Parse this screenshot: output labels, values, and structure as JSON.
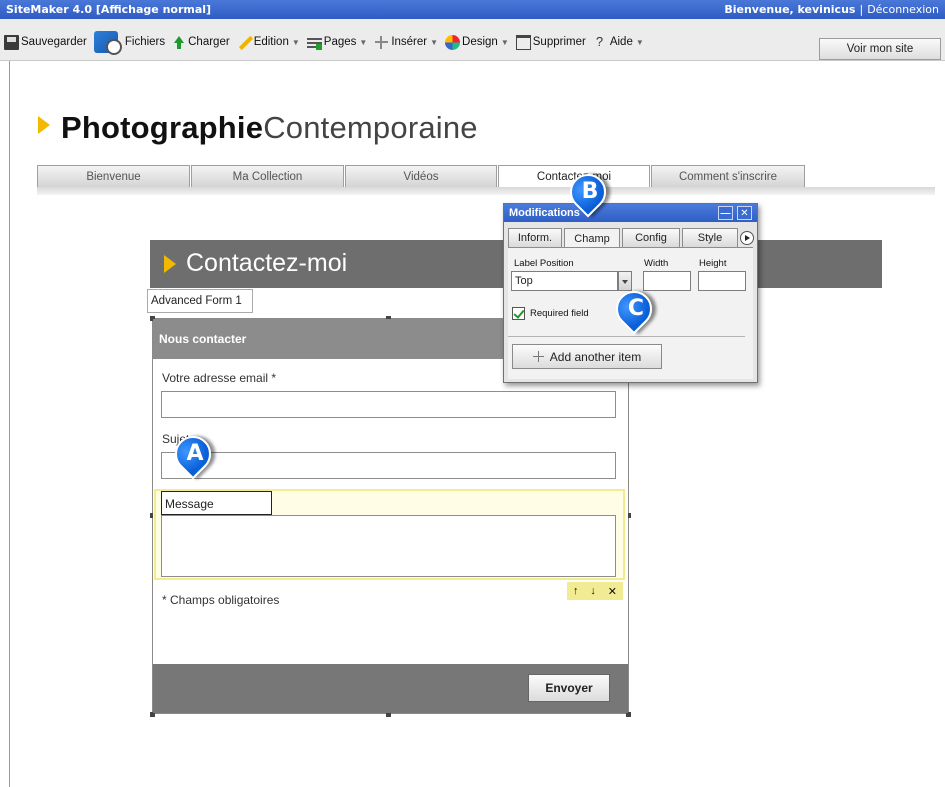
{
  "titlebar": {
    "app": "SiteMaker 4.0  [Affichage normal]",
    "welcome": "Bienvenue, kevinicus",
    "logout": "Déconnexion"
  },
  "toolbar": {
    "items": [
      {
        "label": "Sauvegarder",
        "icon": "save-icon"
      },
      {
        "label": "Fichiers",
        "icon": "files-icon"
      },
      {
        "label": "Charger",
        "icon": "upload-arrow-icon"
      },
      {
        "label": "Edition",
        "icon": "pencil-icon",
        "dropdown": true
      },
      {
        "label": "Pages",
        "icon": "pages-icon",
        "dropdown": true
      },
      {
        "label": "Insérer",
        "icon": "insert-icon",
        "dropdown": true
      },
      {
        "label": "Design",
        "icon": "design-icon",
        "dropdown": true
      },
      {
        "label": "Supprimer",
        "icon": "delete-icon"
      },
      {
        "label": "Aide",
        "icon": "help-icon",
        "dropdown": true
      }
    ],
    "view_site": "Voir mon site"
  },
  "site": {
    "title_bold": "Photographie",
    "title_light": "Contemporaine",
    "accent_color": "#f2b900",
    "nav": [
      "Bienvenue",
      "Ma Collection",
      "Vidéos",
      "Contactez-moi",
      "Comment s'inscrire"
    ],
    "active_nav": "Contactez-moi"
  },
  "page": {
    "heading": "Contactez-moi"
  },
  "form": {
    "name_label": "Advanced Form 1",
    "header": "Nous contacter",
    "email_label": "Votre adresse email *",
    "subject_label": "Sujet",
    "message_label": "Message",
    "required_note": "* Champs obligatoires",
    "submit": "Envoyer",
    "field_controls": {
      "up": "↑",
      "down": "↓",
      "remove": "✕"
    }
  },
  "panel": {
    "title": "Modifications",
    "tabs": [
      "Inform.",
      "Champ",
      "Config",
      "Style"
    ],
    "active_tab": "Champ",
    "label_position_label": "Label Position",
    "label_position_value": "Top",
    "width_label": "Width",
    "height_label": "Height",
    "required_label": "Required field",
    "required_checked": true,
    "add_item": "Add another item",
    "title_color": "#2f5ec6"
  },
  "callouts": [
    {
      "letter": "A",
      "target": "message-label"
    },
    {
      "letter": "B",
      "target": "tab-champ"
    },
    {
      "letter": "C",
      "target": "add-another-item-button"
    }
  ]
}
